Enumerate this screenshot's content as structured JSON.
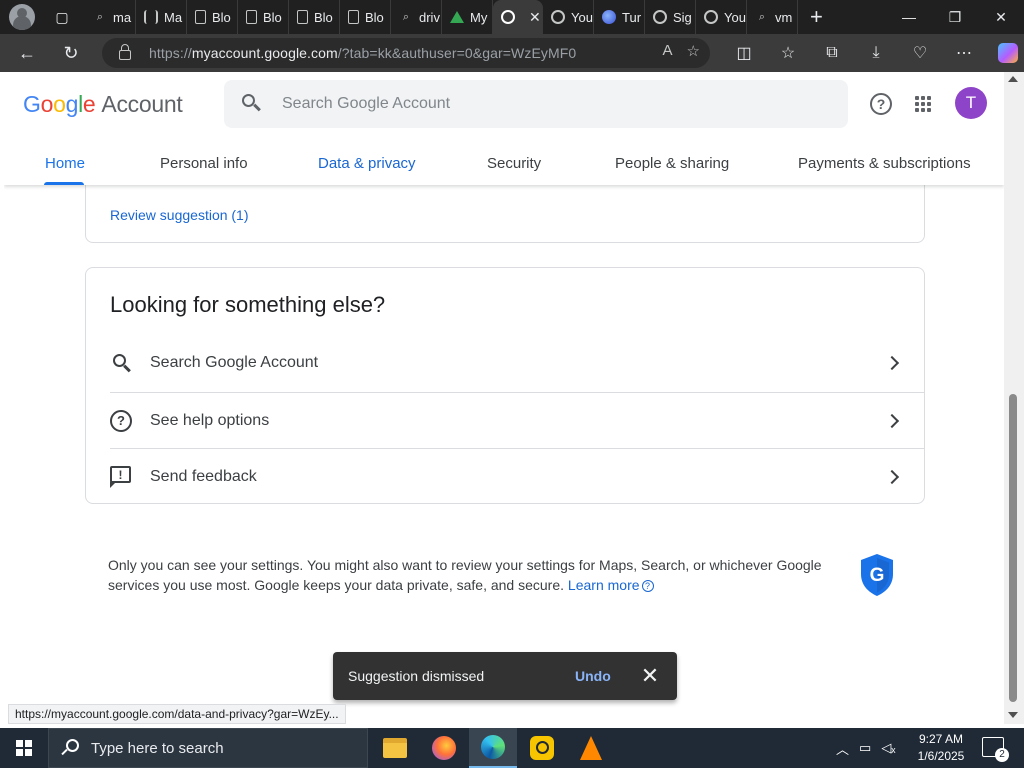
{
  "browser": {
    "tabs": [
      {
        "title": "ma",
        "icon": "search-icon"
      },
      {
        "title": "Ma",
        "icon": "library-icon"
      },
      {
        "title": "Blo",
        "icon": "document-icon"
      },
      {
        "title": "Blo",
        "icon": "document-icon"
      },
      {
        "title": "Blo",
        "icon": "document-icon"
      },
      {
        "title": "Blo",
        "icon": "document-icon"
      },
      {
        "title": "driv",
        "icon": "search-icon"
      },
      {
        "title": "My",
        "icon": "google-drive-icon"
      },
      {
        "title": "",
        "icon": "google-icon",
        "active": true
      },
      {
        "title": "You",
        "icon": "google-icon"
      },
      {
        "title": "Tur",
        "icon": "globe-icon"
      },
      {
        "title": "Sig",
        "icon": "google-icon"
      },
      {
        "title": "You",
        "icon": "google-icon"
      },
      {
        "title": "vm",
        "icon": "search-icon"
      }
    ],
    "url_prefix": "https://",
    "url_host": "myaccount.google.com",
    "url_path": "/?tab=kk&authuser=0&gar=WzEyMF0"
  },
  "header": {
    "logo_google": "Google",
    "logo_account": "Account",
    "search_placeholder": "Search Google Account",
    "avatar_letter": "T"
  },
  "nav_tabs": [
    {
      "label": "Home",
      "active": true
    },
    {
      "label": "Personal info"
    },
    {
      "label": "Data & privacy"
    },
    {
      "label": "Security"
    },
    {
      "label": "People & sharing"
    },
    {
      "label": "Payments & subscriptions"
    }
  ],
  "review_card": {
    "link": "Review suggestion (1)"
  },
  "looking_card": {
    "title": "Looking for something else?",
    "rows": [
      {
        "label": "Search Google Account",
        "icon": "search-icon"
      },
      {
        "label": "See help options",
        "icon": "help-circle-icon"
      },
      {
        "label": "Send feedback",
        "icon": "feedback-icon"
      }
    ]
  },
  "footer": {
    "text": "Only you can see your settings. You might also want to review your settings for Maps, Search, or whichever Google services you use most. Google keeps your data private, safe, and secure.",
    "learn_more": "Learn more"
  },
  "snackbar": {
    "message": "Suggestion dismissed",
    "action": "Undo"
  },
  "status_url": "https://myaccount.google.com/data-and-privacy?gar=WzEy...",
  "taskbar": {
    "search_placeholder": "Type here to search",
    "time": "9:27 AM",
    "date": "1/6/2025",
    "notification_count": "2"
  },
  "colors": {
    "accent": "#1a73e8",
    "avatar": "#8e44c8",
    "shield": "#1a73e8"
  }
}
